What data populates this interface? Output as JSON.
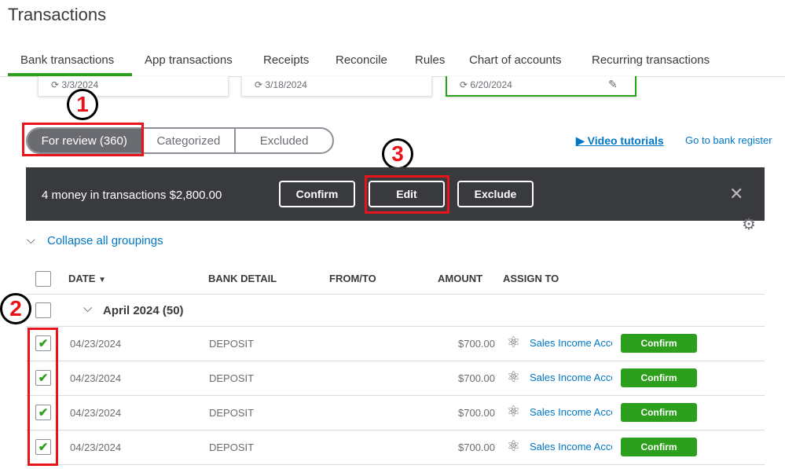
{
  "page_title": "Transactions",
  "tabs": [
    "Bank transactions",
    "App transactions",
    "Receipts",
    "Reconcile",
    "Rules",
    "Chart of accounts",
    "Recurring transactions"
  ],
  "cards": [
    {
      "date": "3/3/2024"
    },
    {
      "date": "3/18/2024"
    },
    {
      "date": "6/20/2024"
    }
  ],
  "annotations": [
    "1",
    "2",
    "3"
  ],
  "segments": [
    "For review (360)",
    "Categorized",
    "Excluded"
  ],
  "video_tutorials": "Video tutorials",
  "bank_register": "Go to bank register",
  "banner": {
    "text": "4 money in transactions $2,800.00",
    "confirm": "Confirm",
    "edit": "Edit",
    "exclude": "Exclude"
  },
  "collapse": "Collapse all groupings",
  "columns": {
    "date": "DATE",
    "bank_detail": "BANK DETAIL",
    "from_to": "FROM/TO",
    "amount": "AMOUNT",
    "assign_to": "ASSIGN TO"
  },
  "group": "April 2024 (50)",
  "rows": [
    {
      "date": "04/23/2024",
      "detail": "DEPOSIT",
      "amount": "$700.00",
      "assign": "Sales Income Account",
      "action": "Confirm",
      "checked": true
    },
    {
      "date": "04/23/2024",
      "detail": "DEPOSIT",
      "amount": "$700.00",
      "assign": "Sales Income Account",
      "action": "Confirm",
      "checked": true
    },
    {
      "date": "04/23/2024",
      "detail": "DEPOSIT",
      "amount": "$700.00",
      "assign": "Sales Income Account",
      "action": "Confirm",
      "checked": true
    },
    {
      "date": "04/23/2024",
      "detail": "DEPOSIT",
      "amount": "$700.00",
      "assign": "Sales Income Account",
      "action": "Confirm",
      "checked": true
    }
  ],
  "colors": {
    "green": "#2ca01c",
    "dark": "#393a3d",
    "link": "#0077c5",
    "annotation": "#e8141b"
  }
}
